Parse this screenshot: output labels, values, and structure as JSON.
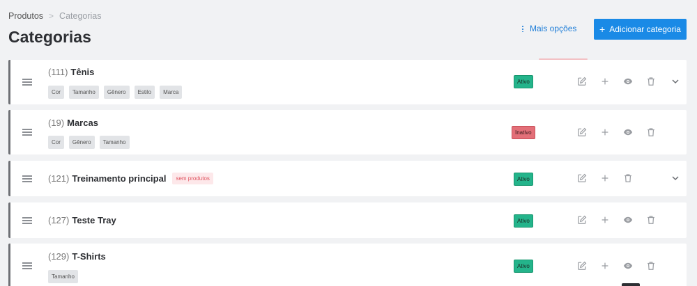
{
  "breadcrumb": {
    "parent": "Produtos",
    "separator": ">",
    "current": "Categorias"
  },
  "page": {
    "title": "Categorias"
  },
  "header": {
    "more_options": "Mais opções",
    "add_category": "Adicionar categoria",
    "add_icon": "+"
  },
  "categories": [
    {
      "id": "(111)",
      "name": "Tênis",
      "tags": [
        "Cor",
        "Tamanho",
        "Gênero",
        "Estilo",
        "Marca"
      ],
      "status": "Ativo",
      "badge": "",
      "has_view": true,
      "expandable": true
    },
    {
      "id": "(19)",
      "name": "Marcas",
      "tags": [
        "Cor",
        "Gênero",
        "Tamanho"
      ],
      "status": "Inativo",
      "badge": "",
      "has_view": true,
      "expandable": false
    },
    {
      "id": "(121)",
      "name": "Treinamento principal",
      "tags": [],
      "status": "Ativo",
      "badge": "sem produtos",
      "has_view": false,
      "expandable": true
    },
    {
      "id": "(127)",
      "name": "Teste Tray",
      "tags": [],
      "status": "Ativo",
      "badge": "",
      "has_view": true,
      "expandable": false
    },
    {
      "id": "(129)",
      "name": "T-Shirts",
      "tags": [
        "Tamanho"
      ],
      "status": "Ativo",
      "badge": "",
      "has_view": true,
      "expandable": false
    }
  ],
  "icons": {
    "edit": "edit-icon",
    "add": "plus-icon",
    "view": "eye-icon",
    "delete": "trash-icon",
    "expand": "chevron-down-icon",
    "drag": "drag-handle-icon"
  },
  "colors": {
    "primary": "#1a8ae6",
    "active": "#24b48b",
    "inactive": "#e36f78",
    "badge_warning": "#fde8ea"
  }
}
